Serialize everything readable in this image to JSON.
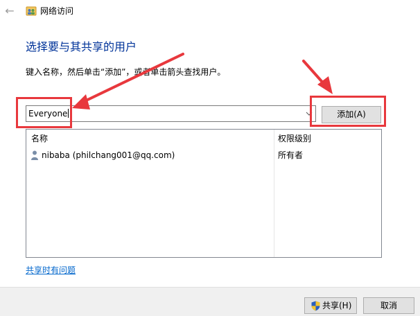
{
  "window": {
    "title": "网络访问",
    "icons": {
      "back": "back-arrow-icon",
      "app": "network-share-icon"
    }
  },
  "main": {
    "heading": "选择要与其共享的用户",
    "instruction": "键入名称，然后单击“添加”，或者单击箭头查找用户。",
    "user_input": {
      "value": "Everyone",
      "dropdown_icon": "chevron-down-icon"
    },
    "add_button": "添加(A)"
  },
  "list": {
    "columns": [
      "名称",
      "权限级别"
    ],
    "rows": [
      {
        "name": "nibaba (philchang001@qq.com)",
        "permission": "所有者",
        "icon": "user-icon"
      }
    ]
  },
  "help_link": "共享时有问题",
  "footer": {
    "share_button": "共享(H)",
    "share_icon": "uac-shield-icon",
    "cancel_button": "取消"
  },
  "colors": {
    "heading": "#003399",
    "link": "#0066cc",
    "annotation": "#e8383d",
    "footer_bg": "#f0f0f0"
  }
}
